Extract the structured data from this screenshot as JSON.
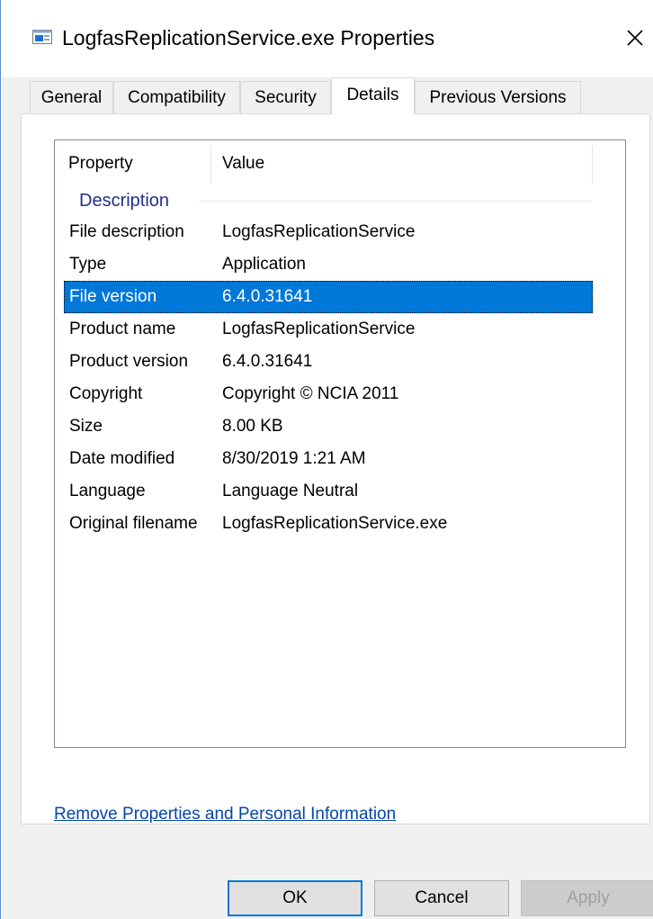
{
  "window": {
    "title": "LogfasReplicationService.exe Properties",
    "accent": "#0078d7"
  },
  "tabs": [
    {
      "label": "General",
      "active": false
    },
    {
      "label": "Compatibility",
      "active": false
    },
    {
      "label": "Security",
      "active": false
    },
    {
      "label": "Details",
      "active": true
    },
    {
      "label": "Previous Versions",
      "active": false
    }
  ],
  "details": {
    "columns": {
      "property": "Property",
      "value": "Value"
    },
    "group": "Description",
    "rows": [
      {
        "property": "File description",
        "value": "LogfasReplicationService"
      },
      {
        "property": "Type",
        "value": "Application"
      },
      {
        "property": "File version",
        "value": "6.4.0.31641",
        "selected": true
      },
      {
        "property": "Product name",
        "value": "LogfasReplicationService"
      },
      {
        "property": "Product version",
        "value": "6.4.0.31641"
      },
      {
        "property": "Copyright",
        "value": "Copyright © NCIA 2011"
      },
      {
        "property": "Size",
        "value": "8.00 KB"
      },
      {
        "property": "Date modified",
        "value": "8/30/2019 1:21 AM"
      },
      {
        "property": "Language",
        "value": "Language Neutral"
      },
      {
        "property": "Original filename",
        "value": "LogfasReplicationService.exe"
      }
    ]
  },
  "link": {
    "label": "Remove Properties and Personal Information"
  },
  "buttons": {
    "ok": "OK",
    "cancel": "Cancel",
    "apply": "Apply"
  },
  "icons": {
    "title": "file-properties-icon",
    "close": "close-icon"
  }
}
